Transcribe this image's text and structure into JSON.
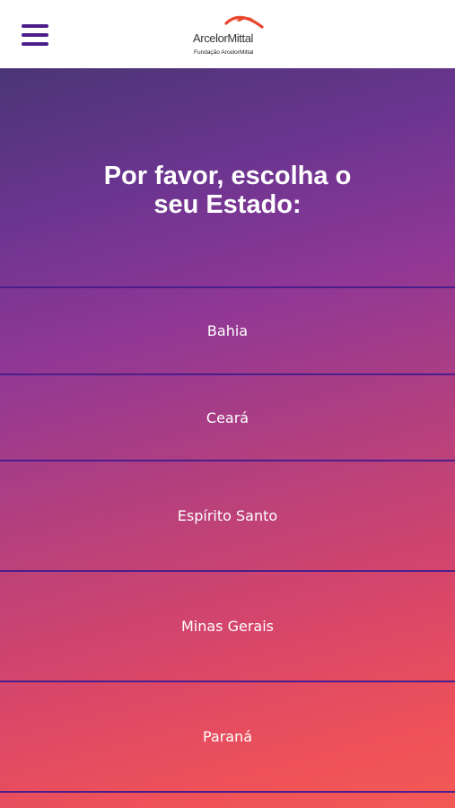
{
  "header": {
    "menu_icon": "hamburger-menu-icon",
    "logo_icon": "arcelormittal-arc-logo-icon",
    "logo_name": "ArcelorMittal",
    "logo_subtitle": "Fundação ArcelorMittal",
    "accent_color": "#4b1e8c",
    "logo_color": "#e8452c"
  },
  "main": {
    "title_line1": "Por favor, escolha o",
    "title_line2": "seu Estado:",
    "states": [
      {
        "label": "Bahia"
      },
      {
        "label": "Ceará"
      },
      {
        "label": "Espírito Santo"
      },
      {
        "label": "Minas Gerais"
      },
      {
        "label": "Paraná"
      }
    ]
  }
}
